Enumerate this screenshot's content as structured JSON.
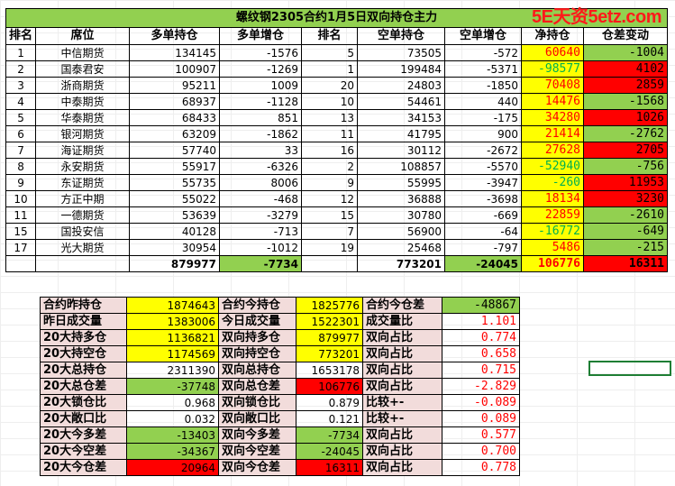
{
  "title": "螺纹钢2305合约1月5日双向持仓主力",
  "watermark": "5E天资5etz.com",
  "headers": [
    "排名",
    "席位",
    "多单持仓",
    "多单增仓",
    "排名",
    "空单持仓",
    "空单增仓",
    "净持仓",
    "仓差变动"
  ],
  "rows": [
    {
      "rank": "1",
      "seat": "中信期货",
      "long": "134145",
      "long_chg": "-1576",
      "srank": "5",
      "short": "73505",
      "short_chg": "-572",
      "net": "60640",
      "net_color": "red",
      "diff": "-1004",
      "diff_color": "green"
    },
    {
      "rank": "2",
      "seat": "国泰君安",
      "long": "100907",
      "long_chg": "-1269",
      "srank": "1",
      "short": "199484",
      "short_chg": "-5371",
      "net": "-98577",
      "net_color": "green",
      "diff": "4102",
      "diff_color": "red"
    },
    {
      "rank": "3",
      "seat": "浙商期货",
      "long": "95211",
      "long_chg": "1009",
      "srank": "20",
      "short": "24803",
      "short_chg": "-1850",
      "net": "70408",
      "net_color": "red",
      "diff": "2859",
      "diff_color": "red"
    },
    {
      "rank": "4",
      "seat": "中泰期货",
      "long": "68937",
      "long_chg": "-1128",
      "srank": "10",
      "short": "54461",
      "short_chg": "440",
      "net": "14476",
      "net_color": "red",
      "diff": "-1568",
      "diff_color": "green"
    },
    {
      "rank": "5",
      "seat": "华泰期货",
      "long": "68433",
      "long_chg": "851",
      "srank": "13",
      "short": "34153",
      "short_chg": "-175",
      "net": "34280",
      "net_color": "red",
      "diff": "1026",
      "diff_color": "red"
    },
    {
      "rank": "6",
      "seat": "银河期货",
      "long": "63209",
      "long_chg": "-1862",
      "srank": "11",
      "short": "41795",
      "short_chg": "900",
      "net": "21414",
      "net_color": "red",
      "diff": "-2762",
      "diff_color": "green"
    },
    {
      "rank": "7",
      "seat": "海证期货",
      "long": "57740",
      "long_chg": "33",
      "srank": "16",
      "short": "30112",
      "short_chg": "-2672",
      "net": "27628",
      "net_color": "red",
      "diff": "2705",
      "diff_color": "red"
    },
    {
      "rank": "8",
      "seat": "永安期货",
      "long": "55917",
      "long_chg": "-6326",
      "srank": "2",
      "short": "108857",
      "short_chg": "-5570",
      "net": "-52940",
      "net_color": "green",
      "diff": "-756",
      "diff_color": "green"
    },
    {
      "rank": "9",
      "seat": "东证期货",
      "long": "55735",
      "long_chg": "8006",
      "srank": "9",
      "short": "55995",
      "short_chg": "-3947",
      "net": "-260",
      "net_color": "green",
      "diff": "11953",
      "diff_color": "red"
    },
    {
      "rank": "10",
      "seat": "方正中期",
      "long": "55022",
      "long_chg": "-468",
      "srank": "12",
      "short": "36888",
      "short_chg": "-3698",
      "net": "18134",
      "net_color": "red",
      "diff": "3230",
      "diff_color": "red"
    },
    {
      "rank": "11",
      "seat": "一德期货",
      "long": "53639",
      "long_chg": "-3279",
      "srank": "15",
      "short": "30780",
      "short_chg": "-669",
      "net": "22859",
      "net_color": "red",
      "diff": "-2610",
      "diff_color": "green"
    },
    {
      "rank": "15",
      "seat": "国投安信",
      "long": "40128",
      "long_chg": "-713",
      "srank": "7",
      "short": "56900",
      "short_chg": "-64",
      "net": "-16772",
      "net_color": "green",
      "diff": "-649",
      "diff_color": "green"
    },
    {
      "rank": "17",
      "seat": "光大期货",
      "long": "30954",
      "long_chg": "-1012",
      "srank": "19",
      "short": "25468",
      "short_chg": "-797",
      "net": "5486",
      "net_color": "red",
      "diff": "-215",
      "diff_color": "green"
    }
  ],
  "totals": {
    "long": "879977",
    "long_chg": "-7734",
    "short": "773201",
    "short_chg": "-24045",
    "net": "106776",
    "diff": "16311"
  },
  "summary": [
    {
      "l1": "合约昨持仓",
      "v1": "1874643",
      "v1bg": "yel",
      "l2": "合约今持仓",
      "v2": "1825776",
      "v2bg": "yel",
      "l3": "合约今仓差",
      "v3": "-48867",
      "v3bg": "grn",
      "v3color": ""
    },
    {
      "l1": "昨日成交量",
      "v1": "1383006",
      "v1bg": "yel",
      "l2": "今日成交量",
      "v2": "1522301",
      "v2bg": "yel",
      "l3": "成交量比",
      "v3": "1.101",
      "v3bg": "",
      "v3color": "red"
    },
    {
      "l1": "20大持多仓",
      "v1": "1136821",
      "v1bg": "yel",
      "l2": "双向持多仓",
      "v2": "879977",
      "v2bg": "yel",
      "l3": "双向占比",
      "v3": "0.774",
      "v3bg": "",
      "v3color": "red"
    },
    {
      "l1": "20大持空仓",
      "v1": "1174569",
      "v1bg": "yel",
      "l2": "双向持空仓",
      "v2": "773201",
      "v2bg": "yel",
      "l3": "双向占比",
      "v3": "0.658",
      "v3bg": "",
      "v3color": "red"
    },
    {
      "l1": "20大总持仓",
      "v1": "2311390",
      "v1bg": "",
      "l2": "双向总持仓",
      "v2": "1653178",
      "v2bg": "",
      "l3": "双向占比",
      "v3": "0.715",
      "v3bg": "",
      "v3color": "red"
    },
    {
      "l1": "20大总仓差",
      "v1": "-37748",
      "v1bg": "grn",
      "l2": "双向总仓差",
      "v2": "106776",
      "v2bg": "red",
      "l3": "双向占比",
      "v3": "-2.829",
      "v3bg": "",
      "v3color": "red"
    },
    {
      "l1": "20大锁仓比",
      "v1": "0.968",
      "v1bg": "",
      "l2": "双向锁仓比",
      "v2": "0.879",
      "v2bg": "",
      "l3": "比较+-",
      "v3": "-0.089",
      "v3bg": "",
      "v3color": "red"
    },
    {
      "l1": "20大敞口比",
      "v1": "0.032",
      "v1bg": "",
      "l2": "双向敞口比",
      "v2": "0.121",
      "v2bg": "",
      "l3": "比较+-",
      "v3": "0.089",
      "v3bg": "",
      "v3color": "red"
    },
    {
      "l1": "20大今多差",
      "v1": "-13403",
      "v1bg": "grn",
      "l2": "双向今多差",
      "v2": "-7734",
      "v2bg": "grn",
      "l3": "双向占比",
      "v3": "0.577",
      "v3bg": "",
      "v3color": "red"
    },
    {
      "l1": "20大今空差",
      "v1": "-34367",
      "v1bg": "grn",
      "l2": "双向今空差",
      "v2": "-24045",
      "v2bg": "grn",
      "l3": "双向占比",
      "v3": "0.700",
      "v3bg": "",
      "v3color": "red"
    },
    {
      "l1": "20大今仓差",
      "v1": "20964",
      "v1bg": "red",
      "l2": "双向今仓差",
      "v2": "16311",
      "v2bg": "red",
      "l3": "双向占比",
      "v3": "0.778",
      "v3bg": "",
      "v3color": "red"
    }
  ]
}
